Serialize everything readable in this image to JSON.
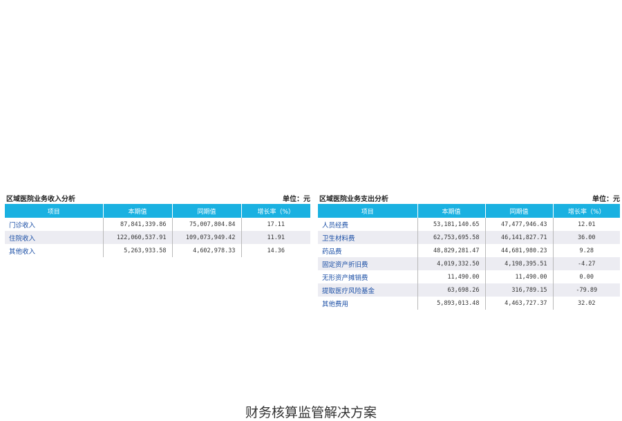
{
  "income": {
    "title": "区域医院业务收入分析",
    "unit": "单位：元",
    "headers": [
      "项目",
      "本期值",
      "同期值",
      "增长率（%）"
    ],
    "rows": [
      {
        "name": "门诊收入",
        "current": "87,841,339.86",
        "prior": "75,007,804.84",
        "rate": "17.11"
      },
      {
        "name": "住院收入",
        "current": "122,060,537.91",
        "prior": "109,073,949.42",
        "rate": "11.91"
      },
      {
        "name": "其他收入",
        "current": "5,263,933.58",
        "prior": "4,602,978.33",
        "rate": "14.36"
      }
    ]
  },
  "expense": {
    "title": "区域医院业务支出分析",
    "unit": "单位：元",
    "headers": [
      "项目",
      "本期值",
      "同期值",
      "增长率（%）"
    ],
    "rows": [
      {
        "name": "人员经费",
        "current": "53,181,140.65",
        "prior": "47,477,946.43",
        "rate": "12.01"
      },
      {
        "name": "卫生材料费",
        "current": "62,753,695.58",
        "prior": "46,141,827.71",
        "rate": "36.00"
      },
      {
        "name": "药品费",
        "current": "48,829,281.47",
        "prior": "44,681,980.23",
        "rate": "9.28"
      },
      {
        "name": "固定资产折旧费",
        "current": "4,019,332.50",
        "prior": "4,198,395.51",
        "rate": "-4.27"
      },
      {
        "name": "无形资产摊销费",
        "current": "11,490.00",
        "prior": "11,490.00",
        "rate": "0.00"
      },
      {
        "name": "提取医疗风险基金",
        "current": "63,698.26",
        "prior": "316,789.15",
        "rate": "-79.89"
      },
      {
        "name": "其他费用",
        "current": "5,893,013.48",
        "prior": "4,463,727.37",
        "rate": "32.02"
      }
    ]
  },
  "caption": "财务核算监管解决方案",
  "colors": {
    "header_bg": "#1ab1e1",
    "link_text": "#1a4ea5",
    "stripe": "#ececf2"
  }
}
